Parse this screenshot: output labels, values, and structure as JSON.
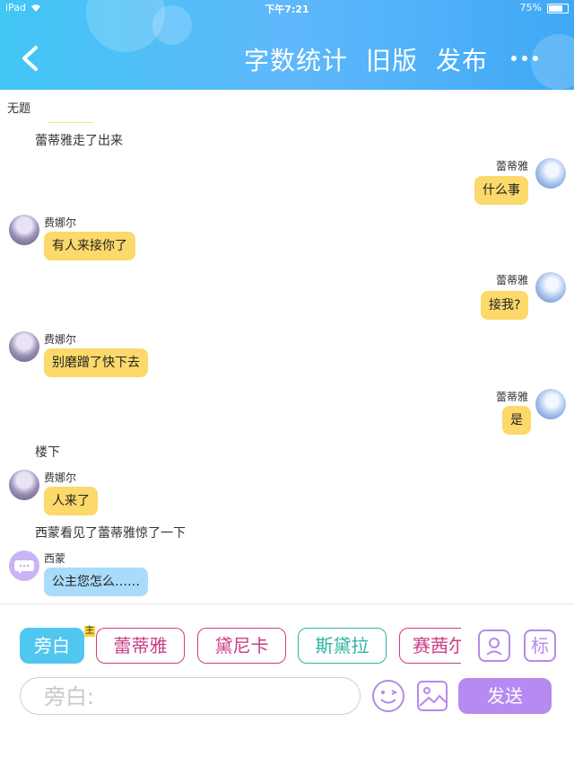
{
  "status_bar": {
    "carrier": "iPad",
    "time": "下午7:21",
    "battery": "75%"
  },
  "header": {
    "actions": [
      "字数统计",
      "旧版",
      "发布"
    ]
  },
  "doc_title": "无题",
  "messages": [
    {
      "kind": "narration",
      "text": "蕾蒂雅走了出来"
    },
    {
      "kind": "right",
      "speaker": "蕾蒂雅",
      "text": "什么事"
    },
    {
      "kind": "left",
      "speaker": "费娜尔",
      "text": "有人来接你了"
    },
    {
      "kind": "right",
      "speaker": "蕾蒂雅",
      "text": "接我?"
    },
    {
      "kind": "left",
      "speaker": "费娜尔",
      "text": "别磨蹭了快下去"
    },
    {
      "kind": "right",
      "speaker": "蕾蒂雅",
      "text": "是"
    },
    {
      "kind": "narration",
      "text": "楼下"
    },
    {
      "kind": "left",
      "speaker": "费娜尔",
      "text": "人来了"
    },
    {
      "kind": "narration",
      "text": "西蒙看见了蕾蒂雅惊了一下"
    },
    {
      "kind": "left",
      "speaker": "西蒙",
      "text": "公主您怎么……"
    }
  ],
  "roles": [
    "旁白",
    "蕾蒂雅",
    "黛尼卡",
    "斯黛拉",
    "赛茜尔"
  ],
  "host_mark": "主",
  "tools": {
    "tag_label": "标"
  },
  "input": {
    "placeholder": "旁白:"
  },
  "send_label": "发送",
  "colors": {
    "header": "#41c6f5",
    "bubble_yellow": "#fbd96a",
    "bubble_blue": "#a9dbfb",
    "send": "#b68af0"
  }
}
